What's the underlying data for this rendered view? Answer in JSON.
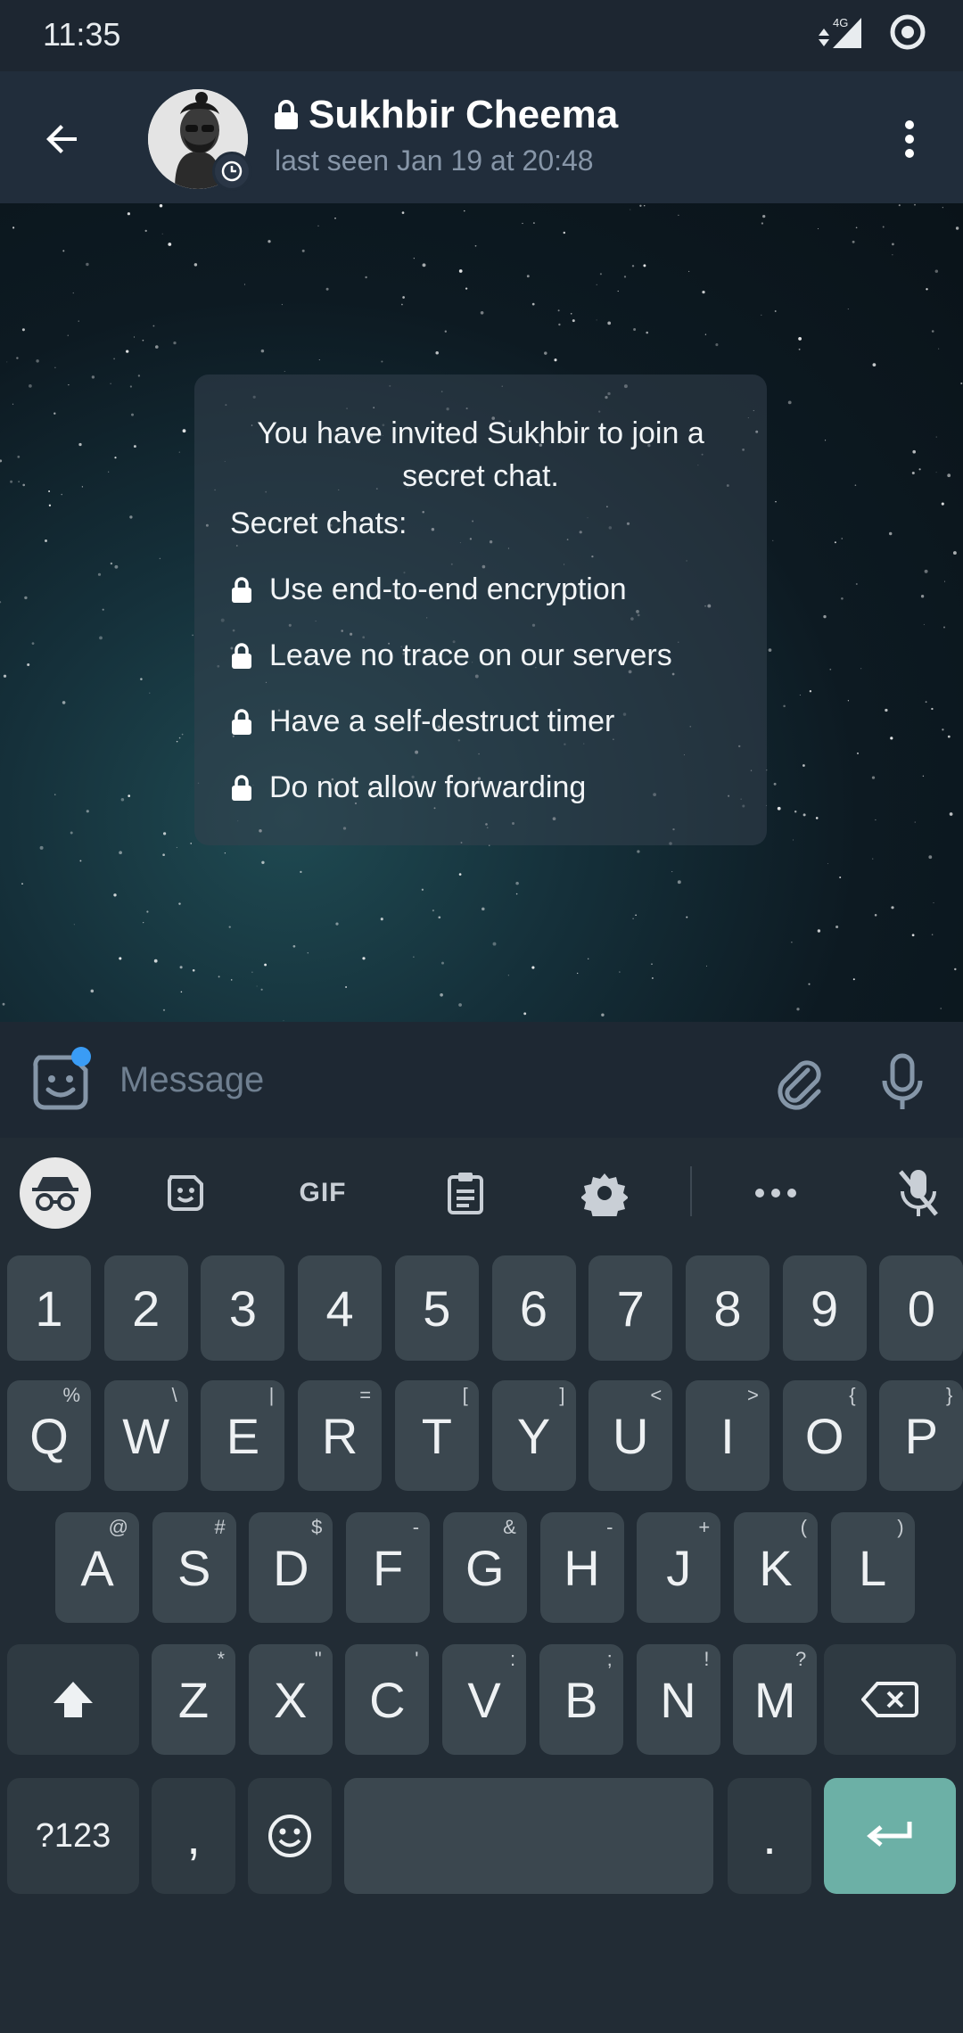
{
  "status_bar": {
    "time": "11:35",
    "network": "4G"
  },
  "header": {
    "back_icon": "arrow-back-icon",
    "title": "Sukhbir Cheema",
    "subtitle": "last seen Jan 19 at 20:48",
    "lock_icon": "lock-icon",
    "menu_icon": "more-vertical-icon"
  },
  "info_card": {
    "intro": "You have invited Sukhbir to join a secret chat.",
    "heading": "Secret chats:",
    "items": [
      "Use end-to-end encryption",
      "Leave no trace on our servers",
      "Have a self-destruct timer",
      "Do not allow forwarding"
    ]
  },
  "input": {
    "placeholder": "Message",
    "sticker_icon": "sticker-icon",
    "attach_icon": "paperclip-icon",
    "mic_icon": "microphone-icon"
  },
  "keyboard": {
    "toolbar": {
      "incognito_icon": "incognito-icon",
      "sticker_icon": "sticker-icon",
      "gif_label": "GIF",
      "clipboard_icon": "clipboard-icon",
      "settings_icon": "gear-icon",
      "more_icon": "more-horizontal-icon",
      "mic_off_icon": "mic-off-icon"
    },
    "row_numbers": [
      "1",
      "2",
      "3",
      "4",
      "5",
      "6",
      "7",
      "8",
      "9",
      "0"
    ],
    "row1": [
      {
        "k": "Q",
        "h": "%"
      },
      {
        "k": "W",
        "h": "\\"
      },
      {
        "k": "E",
        "h": "|"
      },
      {
        "k": "R",
        "h": "="
      },
      {
        "k": "T",
        "h": "["
      },
      {
        "k": "Y",
        "h": "]"
      },
      {
        "k": "U",
        "h": "<"
      },
      {
        "k": "I",
        "h": ">"
      },
      {
        "k": "O",
        "h": "{"
      },
      {
        "k": "P",
        "h": "}"
      }
    ],
    "row2": [
      {
        "k": "A",
        "h": "@"
      },
      {
        "k": "S",
        "h": "#"
      },
      {
        "k": "D",
        "h": "$"
      },
      {
        "k": "F",
        "h": "-"
      },
      {
        "k": "G",
        "h": "&"
      },
      {
        "k": "H",
        "h": "-"
      },
      {
        "k": "J",
        "h": "+"
      },
      {
        "k": "K",
        "h": "("
      },
      {
        "k": "L",
        "h": ")"
      }
    ],
    "row3": [
      {
        "k": "Z",
        "h": "*"
      },
      {
        "k": "X",
        "h": "\""
      },
      {
        "k": "C",
        "h": "'"
      },
      {
        "k": "V",
        "h": ":"
      },
      {
        "k": "B",
        "h": ";"
      },
      {
        "k": "N",
        "h": "!"
      },
      {
        "k": "M",
        "h": "?"
      }
    ],
    "symbols_label": "?123",
    "comma": ",",
    "period": ".",
    "shift_icon": "shift-icon",
    "backspace_icon": "backspace-icon",
    "emoji_icon": "emoji-icon",
    "enter_icon": "enter-icon"
  }
}
